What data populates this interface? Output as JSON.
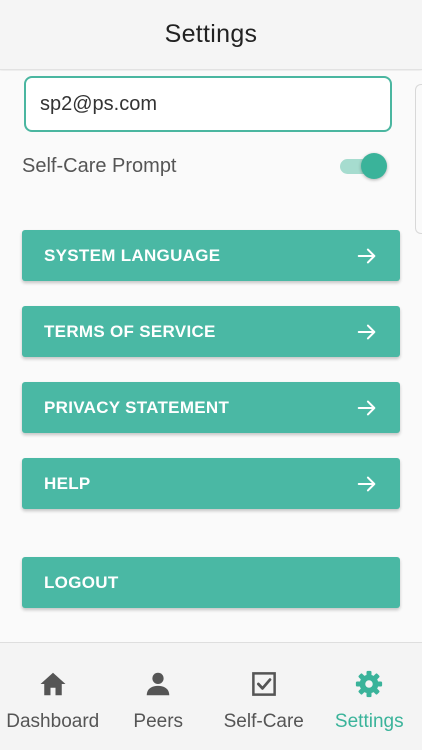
{
  "header": {
    "title": "Settings"
  },
  "account": {
    "email": "sp2@ps.com"
  },
  "self_care_prompt": {
    "label": "Self-Care Prompt",
    "enabled": true
  },
  "menu": {
    "system_language": "SYSTEM LANGUAGE",
    "terms_of_service": "TERMS OF SERVICE",
    "privacy_statement": "PRIVACY STATEMENT",
    "help": "HELP",
    "logout": "LOGOUT"
  },
  "tabs": [
    {
      "label": "Dashboard",
      "icon": "home-icon",
      "active": false
    },
    {
      "label": "Peers",
      "icon": "person-icon",
      "active": false
    },
    {
      "label": "Self-Care",
      "icon": "checkbox-icon",
      "active": false
    },
    {
      "label": "Settings",
      "icon": "gear-icon",
      "active": true
    }
  ],
  "colors": {
    "accent": "#4ab8a4",
    "active_tab": "#3ab39a",
    "inactive_tab": "#555555"
  }
}
